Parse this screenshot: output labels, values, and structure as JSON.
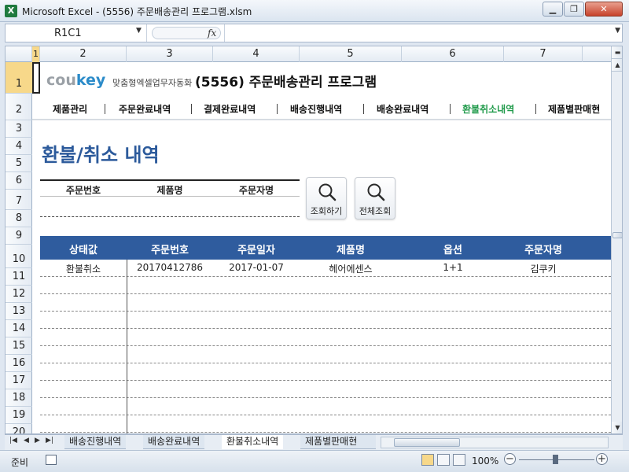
{
  "window": {
    "title": "Microsoft Excel - (5556) 주문배송관리 프로그램.xlsm",
    "app_icon": "X",
    "buttons": [
      "minimize-icon",
      "restore-icon",
      "close-icon"
    ]
  },
  "formula_bar": {
    "name_box": "R1C1",
    "fx_label": "fx",
    "formula": ""
  },
  "columns": [
    "1",
    "2",
    "3",
    "4",
    "5",
    "6",
    "7"
  ],
  "rows": [
    "1",
    "2",
    "3",
    "4",
    "5",
    "6",
    "7",
    "8",
    "9",
    "10",
    "11",
    "12",
    "13",
    "14",
    "15",
    "16",
    "17",
    "18",
    "19",
    "20"
  ],
  "header": {
    "logo_main": "cou",
    "logo_accent": "key",
    "tagline": "맞춤형엑셀업무자동화",
    "title": "(5556) 주문배송관리 프로그램"
  },
  "nav": {
    "items": [
      "제품관리",
      "주문완료내역",
      "결제완료내역",
      "배송진행내역",
      "배송완료내역",
      "환불취소내역",
      "제품별판매현"
    ],
    "active_index": 5
  },
  "section_title": "환불/취소 내역",
  "search": {
    "headers": [
      "주문번호",
      "제품명",
      "주문자명"
    ],
    "values": [
      "",
      "",
      ""
    ],
    "buttons": [
      "조회하기",
      "전체조회"
    ]
  },
  "table": {
    "headers": [
      "상태값",
      "주문번호",
      "주문일자",
      "제품명",
      "옵션",
      "주문자명"
    ],
    "rows": [
      [
        "환불취소",
        "20170412786",
        "2017-01-07",
        "헤어에센스",
        "1+1",
        "김쿠키"
      ]
    ]
  },
  "sheet_tabs": [
    "배송진행내역",
    "배송완료내역",
    "환불취소내역",
    "제품별판매현"
  ],
  "active_sheet": "환불취소내역",
  "status": {
    "ready": "준비",
    "zoom": "100%"
  }
}
